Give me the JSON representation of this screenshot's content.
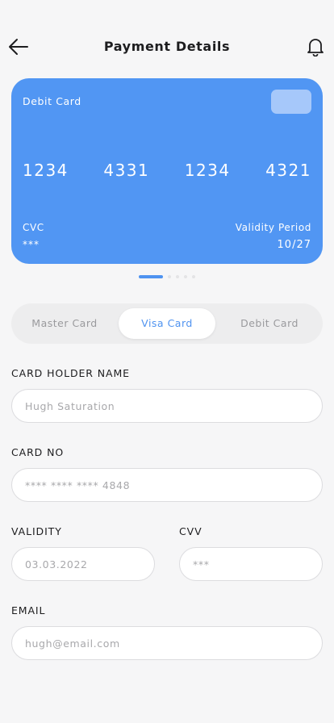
{
  "header": {
    "title": "Payment Details",
    "back_icon": "arrow-left-icon",
    "notification_icon": "bell-icon"
  },
  "card": {
    "type_label": "Debit Card",
    "number_groups": [
      "1234",
      "4331",
      "1234",
      "4321"
    ],
    "cvc_label": "CVC",
    "cvc_value": "***",
    "validity_label": "Validity Period",
    "validity_value": "10/27",
    "color": "#5196f3"
  },
  "pager": {
    "count": 5,
    "active_index": 0
  },
  "card_types": {
    "selected": "Visa Card",
    "options": [
      "Master Card",
      "Visa Card",
      "Debit Card"
    ]
  },
  "form": {
    "holder_name": {
      "label": "CARD HOLDER NAME",
      "placeholder": "Hugh Saturation"
    },
    "card_no": {
      "label": "CARD NO",
      "placeholder": "**** **** **** 4848"
    },
    "validity": {
      "label": "VALIDITY",
      "placeholder": "03.03.2022"
    },
    "cvv": {
      "label": "CVV",
      "placeholder": "***"
    },
    "email": {
      "label": "EMAIL",
      "placeholder": "hugh@email.com"
    }
  },
  "colors": {
    "accent": "#4f93f0",
    "background": "#f6f6f7"
  }
}
